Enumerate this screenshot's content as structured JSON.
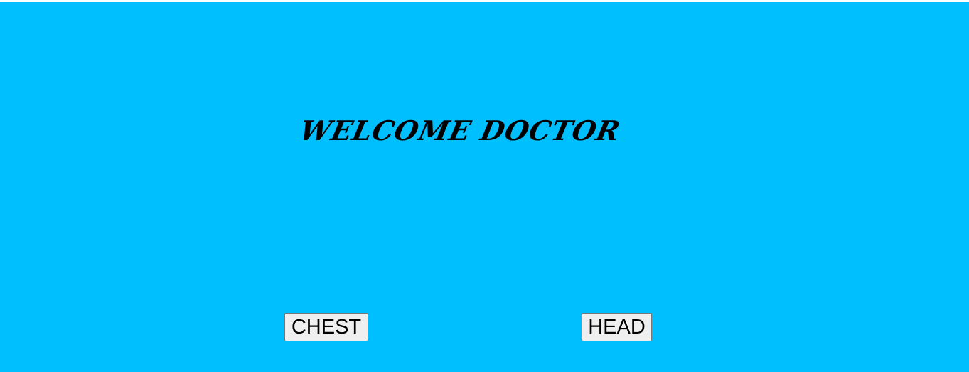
{
  "theme": {
    "background": "#00bfff",
    "button_background": "#efefef",
    "text_color": "#000000"
  },
  "header": {
    "title": "WELCOME DOCTOR"
  },
  "actions": {
    "chest_label": "CHEST",
    "head_label": "HEAD"
  }
}
